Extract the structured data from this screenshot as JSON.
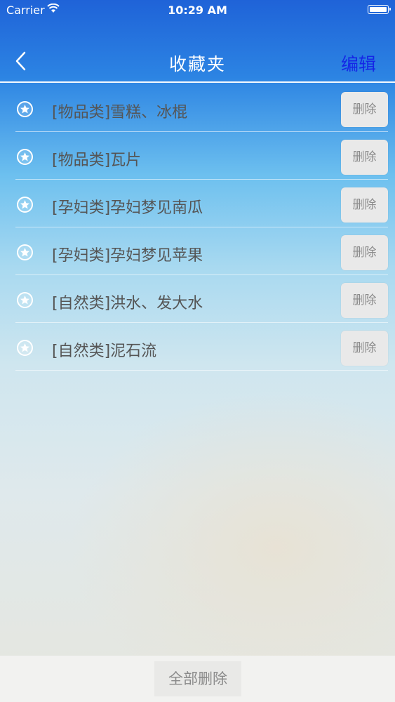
{
  "status": {
    "carrier": "Carrier",
    "time": "10:29 AM"
  },
  "nav": {
    "title": "收藏夹",
    "edit_label": "编辑"
  },
  "favorites": [
    {
      "text": "[物品类]雪糕、冰棍",
      "delete_label": "删除"
    },
    {
      "text": "[物品类]瓦片",
      "delete_label": "删除"
    },
    {
      "text": "[孕妇类]孕妇梦见南瓜",
      "delete_label": "删除"
    },
    {
      "text": "[孕妇类]孕妇梦见苹果",
      "delete_label": "删除"
    },
    {
      "text": "[自然类]洪水、发大水",
      "delete_label": "删除"
    },
    {
      "text": "[自然类]泥石流",
      "delete_label": "删除"
    }
  ],
  "footer": {
    "delete_all_label": "全部删除"
  },
  "icons": {
    "back": "chevron-left-icon",
    "row": "star-circle-icon",
    "wifi": "wifi-icon",
    "battery": "battery-icon"
  },
  "colors": {
    "edit": "#1526e6",
    "nav_gradient_top": "#1f63d8"
  }
}
